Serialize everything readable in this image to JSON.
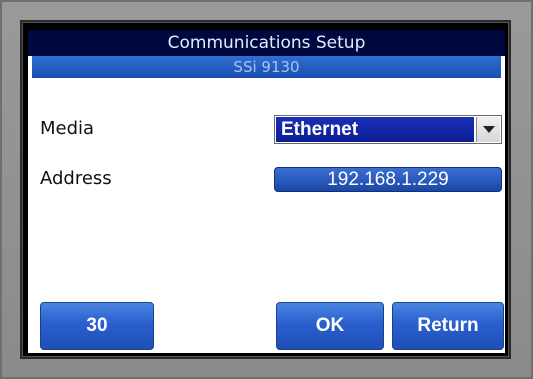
{
  "header": {
    "title": "Communications Setup",
    "subtitle": "SSi 9130"
  },
  "form": {
    "media_label": "Media",
    "media_value": "Ethernet",
    "address_label": "Address",
    "address_value": "192.168.1.229"
  },
  "buttons": {
    "left_label": "30",
    "ok_label": "OK",
    "return_label": "Return"
  },
  "colors": {
    "title_bar": "#000840",
    "accent_blue": "#2a5fcd",
    "dropdown_selected": "#0d1d95",
    "bezel": "#8a8a8a"
  },
  "icons": {
    "dropdown_arrow": "chevron-down-icon"
  }
}
